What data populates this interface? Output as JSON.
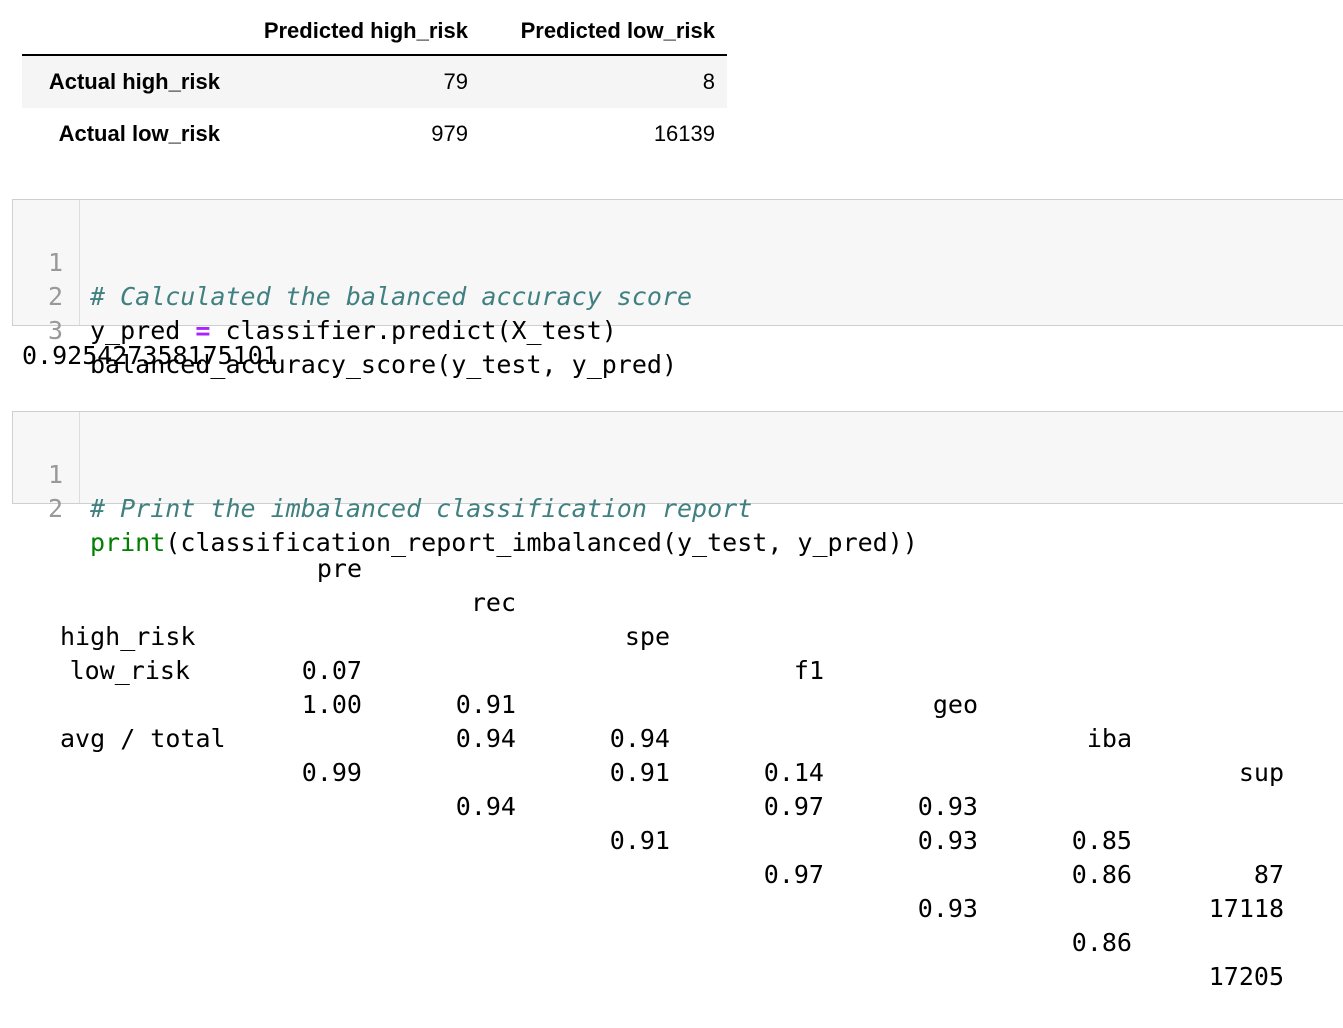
{
  "confusion_matrix": {
    "columns": [
      "Predicted high_risk",
      "Predicted low_risk"
    ],
    "rows": [
      {
        "label": "Actual high_risk",
        "values": [
          "79",
          "8"
        ]
      },
      {
        "label": "Actual low_risk",
        "values": [
          "979",
          "16139"
        ]
      }
    ]
  },
  "cell1": {
    "line_numbers": [
      "1",
      "2",
      "3"
    ],
    "line1_comment": "# Calculated the balanced accuracy score",
    "line2_a": "y_pred ",
    "line2_op": "=",
    "line2_b": " classifier.predict(X_test)",
    "line3": "balanced_accuracy_score(y_test, y_pred)"
  },
  "cell1_output": "0.925427358175101",
  "cell2": {
    "line_numbers": [
      "1",
      "2"
    ],
    "line1_comment": "# Print the imbalanced classification report",
    "line2_builtin": "print",
    "line2_rest": "(classification_report_imbalanced(y_test, y_pred))"
  },
  "report": {
    "headers": [
      "pre",
      "rec",
      "spe",
      "f1",
      "geo",
      "iba",
      "sup"
    ],
    "rows": [
      {
        "label": "high_risk",
        "values": [
          "0.07",
          "0.91",
          "0.94",
          "0.14",
          "0.93",
          "0.85",
          "87"
        ]
      },
      {
        "label": "low_risk",
        "values": [
          "1.00",
          "0.94",
          "0.91",
          "0.97",
          "0.93",
          "0.86",
          "17118"
        ]
      },
      {
        "label": "avg / total",
        "values": [
          "0.99",
          "0.94",
          "0.91",
          "0.97",
          "0.93",
          "0.86",
          "17205"
        ]
      }
    ]
  }
}
